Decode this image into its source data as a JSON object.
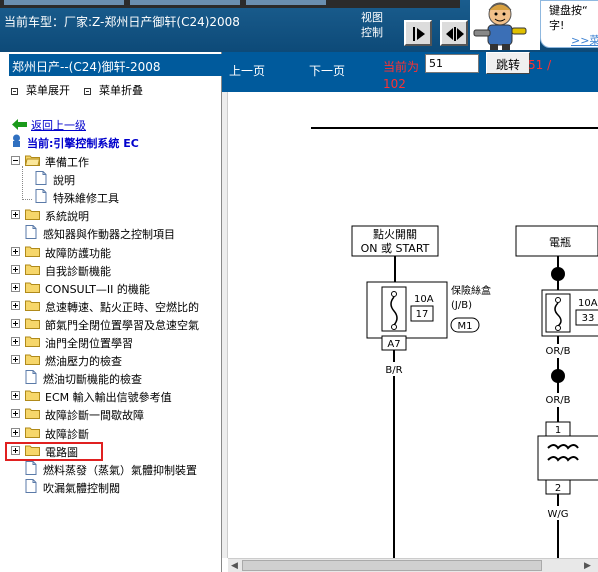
{
  "header": {
    "car_info": "当前车型：厂家:Z-郑州日产御轩(C24)2008",
    "view_control": "视图\n控制",
    "tip_text": "键盘按“\n字!",
    "tip_link": ">>菜"
  },
  "sidebar": {
    "title": "郑州日产--(C24)御轩-2008",
    "expand_label": "菜单展开",
    "collapse_label": "菜单折叠",
    "back_link": "返回上一级",
    "current_label": "当前:引擎控制系統 EC",
    "tree": [
      {
        "label": "準備工作",
        "indent": 0,
        "toggle": "minus",
        "icon": "folder-open"
      },
      {
        "label": "說明",
        "indent": 1,
        "toggle": "",
        "icon": "doc"
      },
      {
        "label": "特殊維修工具",
        "indent": 1,
        "toggle": "",
        "icon": "doc"
      },
      {
        "label": "系統說明",
        "indent": 0,
        "toggle": "plus",
        "icon": "folder"
      },
      {
        "label": "感知器與作動器之控制項目",
        "indent": 0,
        "toggle": "",
        "icon": "doc"
      },
      {
        "label": "故障防護功能",
        "indent": 0,
        "toggle": "plus",
        "icon": "folder"
      },
      {
        "label": "自我診斷機能",
        "indent": 0,
        "toggle": "plus",
        "icon": "folder"
      },
      {
        "label": "CONSULT—II 的機能",
        "indent": 0,
        "toggle": "plus",
        "icon": "folder"
      },
      {
        "label": "怠速轉速、點火正時、空燃比的",
        "indent": 0,
        "toggle": "plus",
        "icon": "folder"
      },
      {
        "label": "節氣門全閉位置學習及怠速空氣",
        "indent": 0,
        "toggle": "plus",
        "icon": "folder"
      },
      {
        "label": "油門全閉位置學習",
        "indent": 0,
        "toggle": "plus",
        "icon": "folder"
      },
      {
        "label": "燃油壓力的檢查",
        "indent": 0,
        "toggle": "plus",
        "icon": "folder"
      },
      {
        "label": "燃油切斷機能的檢查",
        "indent": 0,
        "toggle": "",
        "icon": "doc"
      },
      {
        "label": "ECM 輸入輸出信號參考值",
        "indent": 0,
        "toggle": "plus",
        "icon": "folder"
      },
      {
        "label": "故障診斷一間歇故障",
        "indent": 0,
        "toggle": "plus",
        "icon": "folder"
      },
      {
        "label": "故障診斷",
        "indent": 0,
        "toggle": "plus",
        "icon": "folder"
      },
      {
        "label": "電路圖",
        "indent": 0,
        "toggle": "plus",
        "icon": "folder"
      },
      {
        "label": "燃料蒸發（蒸氣）氣體抑制裝置",
        "indent": 0,
        "toggle": "",
        "icon": "doc"
      },
      {
        "label": "吹漏氣體控制閥",
        "indent": 0,
        "toggle": "",
        "icon": "doc"
      }
    ]
  },
  "toolbar": {
    "prev_label": "上一页",
    "next_label": "下一页",
    "current_label": "当前为",
    "page_value": "51",
    "jump_label": "跳转",
    "page_total_a": "51 /",
    "page_total_b": "102"
  },
  "diagram": {
    "ignition_switch_l1": "點火開關",
    "ignition_switch_l2": "ON 或 START",
    "fuse_box_l1": "保險絲盒",
    "fuse_box_l2": "(J/B)",
    "fuse_left_amp": "10A",
    "fuse_left_num": "17",
    "connector_m1": "M1",
    "connector_a7": "A7",
    "wire_br": "B/R",
    "battery_label": "電瓶",
    "fuse_right_amp": "10A",
    "fuse_right_num": "33",
    "wire_orb_1": "OR/B",
    "wire_orb_2": "OR/B",
    "relay_pin1": "1",
    "relay_pin2": "2",
    "wire_wg": "W/G"
  }
}
